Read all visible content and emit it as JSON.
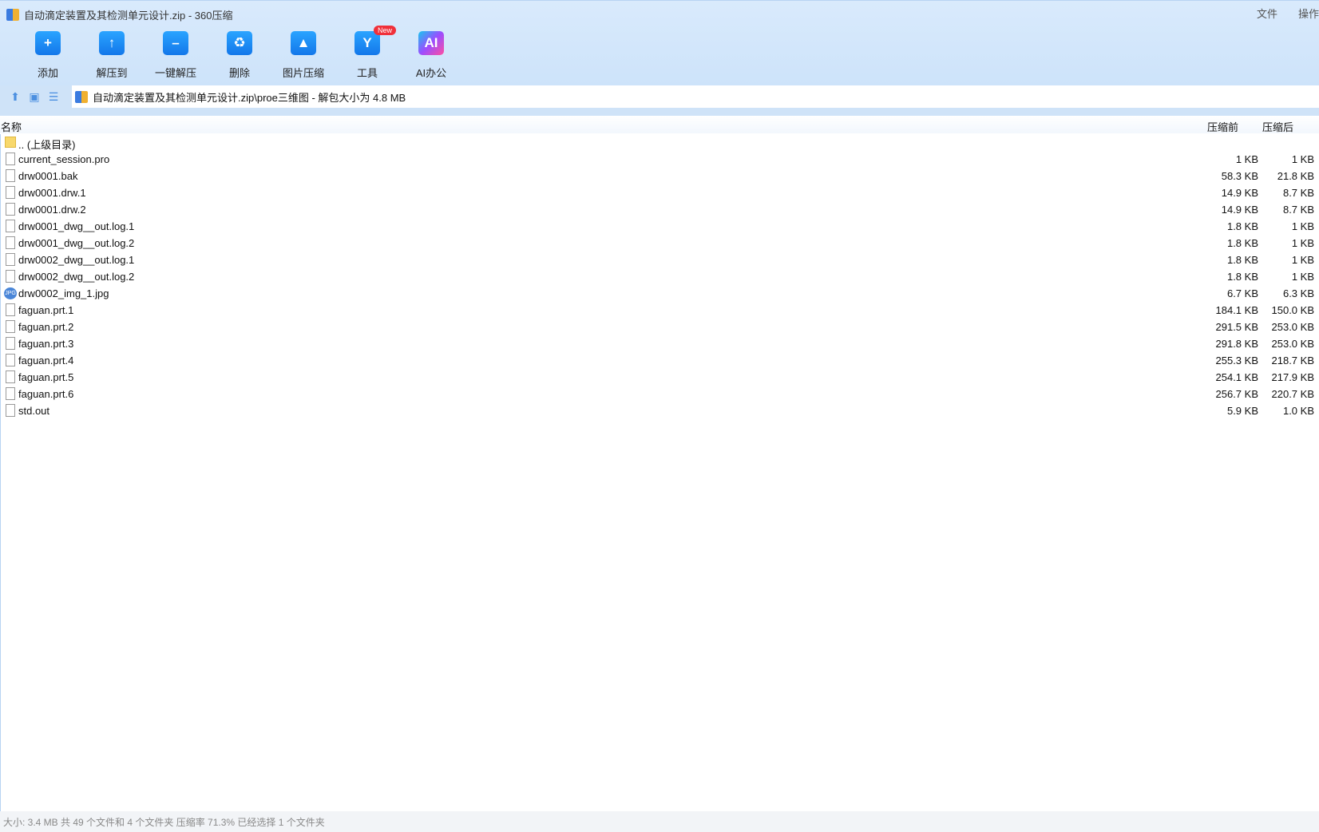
{
  "window": {
    "title": "自动滴定装置及其检测单元设计.zip - 360压缩"
  },
  "menu": [
    "文件",
    "操作"
  ],
  "toolbar": [
    {
      "label": "添加",
      "icon": "add-folder-icon",
      "glyph": "+"
    },
    {
      "label": "解压到",
      "icon": "extract-to-icon",
      "glyph": "↑"
    },
    {
      "label": "一键解压",
      "icon": "one-click-extract-icon",
      "glyph": "–"
    },
    {
      "label": "删除",
      "icon": "recycle-bin-icon",
      "glyph": "♻"
    },
    {
      "label": "图片压缩",
      "icon": "image-compress-icon",
      "glyph": "▲"
    },
    {
      "label": "工具",
      "icon": "tools-icon",
      "glyph": "Y",
      "badge": "New"
    },
    {
      "label": "AI办公",
      "icon": "ai-office-icon",
      "glyph": "AI"
    }
  ],
  "address": {
    "path": "自动滴定装置及其检测单元设计.zip\\proe三维图 - 解包大小为 4.8 MB"
  },
  "columns": {
    "name": "名称",
    "before": "压缩前",
    "after": "压缩后"
  },
  "files": [
    {
      "name": ".. (上级目录)",
      "type": "folder",
      "before": "",
      "after": ""
    },
    {
      "name": "current_session.pro",
      "type": "file",
      "before": "1 KB",
      "after": "1 KB"
    },
    {
      "name": "drw0001.bak",
      "type": "file",
      "before": "58.3 KB",
      "after": "21.8 KB"
    },
    {
      "name": "drw0001.drw.1",
      "type": "file",
      "before": "14.9 KB",
      "after": "8.7 KB"
    },
    {
      "name": "drw0001.drw.2",
      "type": "file",
      "before": "14.9 KB",
      "after": "8.7 KB"
    },
    {
      "name": "drw0001_dwg__out.log.1",
      "type": "file",
      "before": "1.8 KB",
      "after": "1 KB"
    },
    {
      "name": "drw0001_dwg__out.log.2",
      "type": "file",
      "before": "1.8 KB",
      "after": "1 KB"
    },
    {
      "name": "drw0002_dwg__out.log.1",
      "type": "file",
      "before": "1.8 KB",
      "after": "1 KB"
    },
    {
      "name": "drw0002_dwg__out.log.2",
      "type": "file",
      "before": "1.8 KB",
      "after": "1 KB"
    },
    {
      "name": "drw0002_img_1.jpg",
      "type": "jpg",
      "before": "6.7 KB",
      "after": "6.3 KB"
    },
    {
      "name": "faguan.prt.1",
      "type": "file",
      "before": "184.1 KB",
      "after": "150.0 KB"
    },
    {
      "name": "faguan.prt.2",
      "type": "file",
      "before": "291.5 KB",
      "after": "253.0 KB"
    },
    {
      "name": "faguan.prt.3",
      "type": "file",
      "before": "291.8 KB",
      "after": "253.0 KB"
    },
    {
      "name": "faguan.prt.4",
      "type": "file",
      "before": "255.3 KB",
      "after": "218.7 KB"
    },
    {
      "name": "faguan.prt.5",
      "type": "file",
      "before": "254.1 KB",
      "after": "217.9 KB"
    },
    {
      "name": "faguan.prt.6",
      "type": "file",
      "before": "256.7 KB",
      "after": "220.7 KB"
    },
    {
      "name": "std.out",
      "type": "file",
      "before": "5.9 KB",
      "after": "1.0 KB"
    }
  ],
  "status": "大小: 3.4 MB 共 49 个文件和 4 个文件夹 压缩率 71.3% 已经选择 1 个文件夹"
}
